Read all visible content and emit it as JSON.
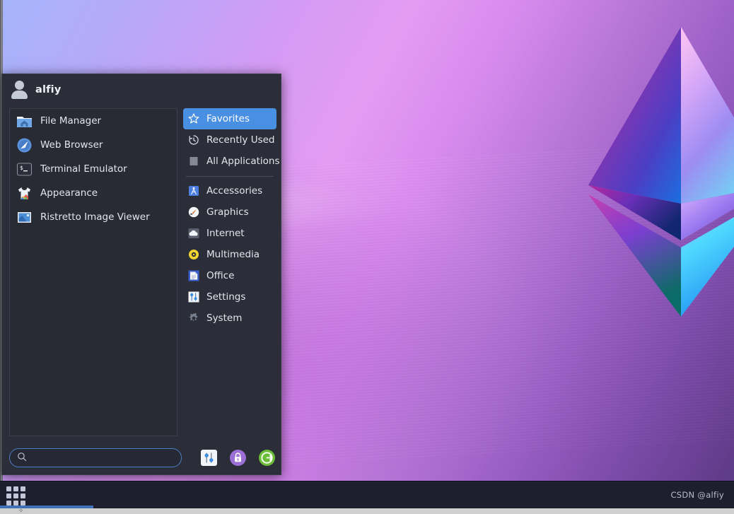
{
  "desktop": {
    "wallpaper_name": "ethereum-purple-gradient",
    "watermark": "CSDN @alfiy",
    "colors": {
      "wallpaper_top_left": "#a5b4fb",
      "wallpaper_mid": "#e49bf2",
      "wallpaper_bottom": "#5e3a86",
      "panel_bg": "#2b2d38",
      "panel_border": "#3b3d4a",
      "accent_blue": "#4a90e2",
      "taskbar_bg": "#1d1f2e",
      "lock_purple": "#9b6fd4",
      "logout_green": "#6cbe3a"
    }
  },
  "menu": {
    "user": "alfiy",
    "avatar_icon": "user-avatar-icon",
    "favorites": [
      {
        "label": "File Manager",
        "icon": "folder-home-icon"
      },
      {
        "label": "Web Browser",
        "icon": "compass-browser-icon"
      },
      {
        "label": "Terminal Emulator",
        "icon": "terminal-prompt-icon"
      },
      {
        "label": "Appearance",
        "icon": "tshirt-appearance-icon"
      },
      {
        "label": "Ristretto Image Viewer",
        "icon": "image-viewer-icon"
      }
    ],
    "views": [
      {
        "label": "Favorites",
        "icon": "star-icon",
        "selected": true
      },
      {
        "label": "Recently Used",
        "icon": "clock-history-icon",
        "selected": false
      },
      {
        "label": "All Applications",
        "icon": "list-lines-icon",
        "selected": false
      }
    ],
    "categories": [
      {
        "label": "Accessories",
        "icon": "accessories-icon"
      },
      {
        "label": "Graphics",
        "icon": "graphics-palette-icon"
      },
      {
        "label": "Internet",
        "icon": "cloud-internet-icon"
      },
      {
        "label": "Multimedia",
        "icon": "disc-multimedia-icon"
      },
      {
        "label": "Office",
        "icon": "document-office-icon"
      },
      {
        "label": "Settings",
        "icon": "sliders-settings-icon"
      },
      {
        "label": "System",
        "icon": "gear-system-icon"
      }
    ],
    "search": {
      "value": "",
      "placeholder": "",
      "icon": "search-magnifier-icon"
    },
    "footer_buttons": [
      {
        "name": "settings-manager-button",
        "icon": "sliders-settings-icon",
        "title": "Settings Manager"
      },
      {
        "name": "lock-screen-button",
        "icon": "padlock-icon",
        "title": "Lock Screen"
      },
      {
        "name": "log-out-button",
        "icon": "power-logout-icon",
        "title": "Log Out"
      }
    ]
  },
  "taskbar": {
    "applications_button_icon": "app-grid-icon",
    "watermark": "CSDN @alfiy"
  }
}
